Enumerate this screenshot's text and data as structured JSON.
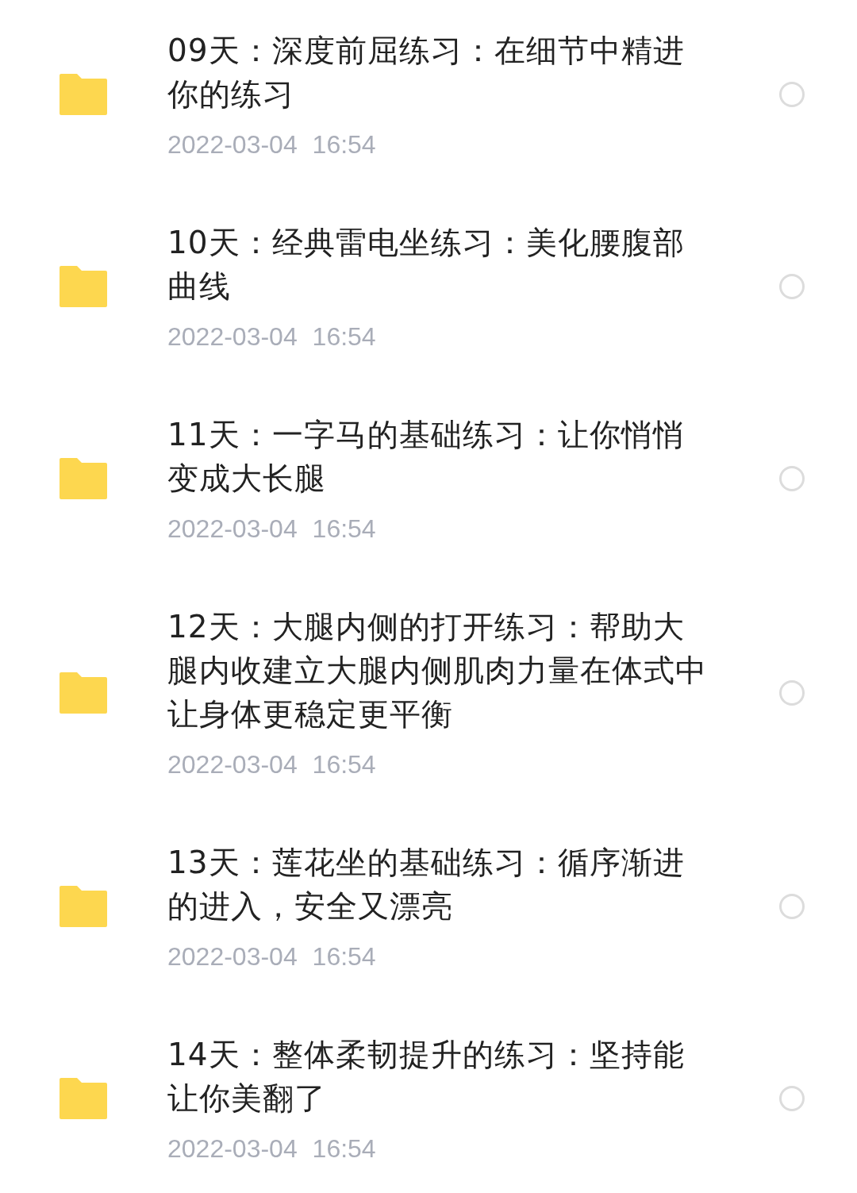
{
  "files": [
    {
      "name": "09天：深度前屈练习：在细节中精进你的练习",
      "date": "2022-03-04 16:54",
      "selected": false
    },
    {
      "name": "10天：经典雷电坐练习：美化腰腹部曲线",
      "date": "2022-03-04 16:54",
      "selected": false
    },
    {
      "name": "11天：一字马的基础练习：让你悄悄变成大长腿",
      "date": "2022-03-04 16:54",
      "selected": false
    },
    {
      "name": "12天：大腿内侧的打开练习：帮助大腿内收建立大腿内侧肌肉力量在体式中让身体更稳定更平衡",
      "date": "2022-03-04 16:54",
      "selected": false
    },
    {
      "name": "13天：莲花坐的基础练习：循序渐进的进入，安全又漂亮",
      "date": "2022-03-04 16:54",
      "selected": false
    },
    {
      "name": "14天：整体柔韧提升的练习：坚持能让你美翻了",
      "date": "2022-03-04 16:54",
      "selected": false
    }
  ]
}
